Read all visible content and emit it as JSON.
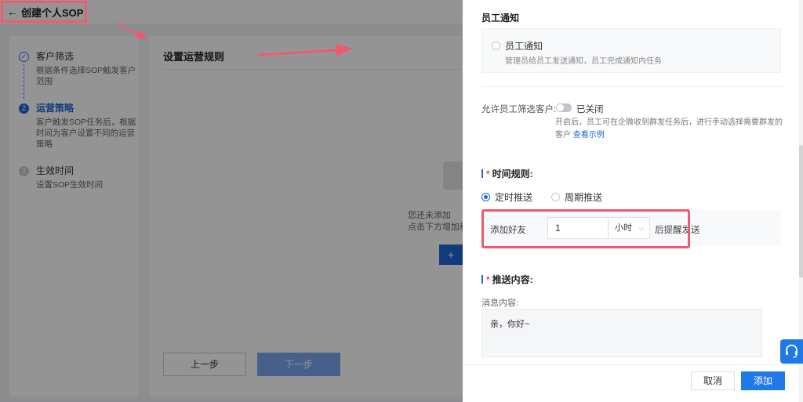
{
  "header": {
    "back_icon": "arrow-left-icon",
    "title": "创建个人SOP"
  },
  "steps": [
    {
      "index": "✓",
      "title": "客户筛选",
      "desc": "根据条件选择SOP触发客户范围",
      "state": "done"
    },
    {
      "index": "2",
      "title": "运营策略",
      "desc": "客户触发SOP任务后，根据时间为客户设置不同的运营策略",
      "state": "active"
    },
    {
      "index": "3",
      "title": "生效时间",
      "desc": "设置SOP生效时间",
      "state": "todo"
    }
  ],
  "main": {
    "title": "设置运营规则",
    "empty_line1": "您还未添加",
    "empty_line2": "点击下方增加和",
    "empty_button": "+",
    "prev_button": "上一步",
    "next_button": "下一步"
  },
  "drawer": {
    "notice_section_title": "员工通知",
    "notice_option": "员工通知",
    "notice_desc": "管理员给员工发送通知，员工完成通知内任务",
    "allow_label": "允许员工筛选客户:",
    "allow_state": "已关闭",
    "allow_desc": "开启后，员工可在企微收到群发任务后，进行手动选择需要群发的客户",
    "allow_link": "查看示例",
    "time_rule_title": "时间规则:",
    "time_options": [
      "定时推送",
      "周期推送"
    ],
    "time_selected_index": 0,
    "time_prefix": "添加好友",
    "time_value": "1",
    "time_unit": "小时",
    "time_suffix": "后提醒发送",
    "content_title": "推送内容:",
    "message_label": "消息内容:",
    "message_value": "亲，你好~",
    "cancel_button": "取消",
    "add_button": "添加"
  },
  "icons": {
    "support": "headset-icon",
    "unit_dropdown": "chevron-down-icon"
  },
  "colors": {
    "primary": "#1f7ae8",
    "highlight": "#ef5b6e",
    "required": "#e94f4f"
  }
}
